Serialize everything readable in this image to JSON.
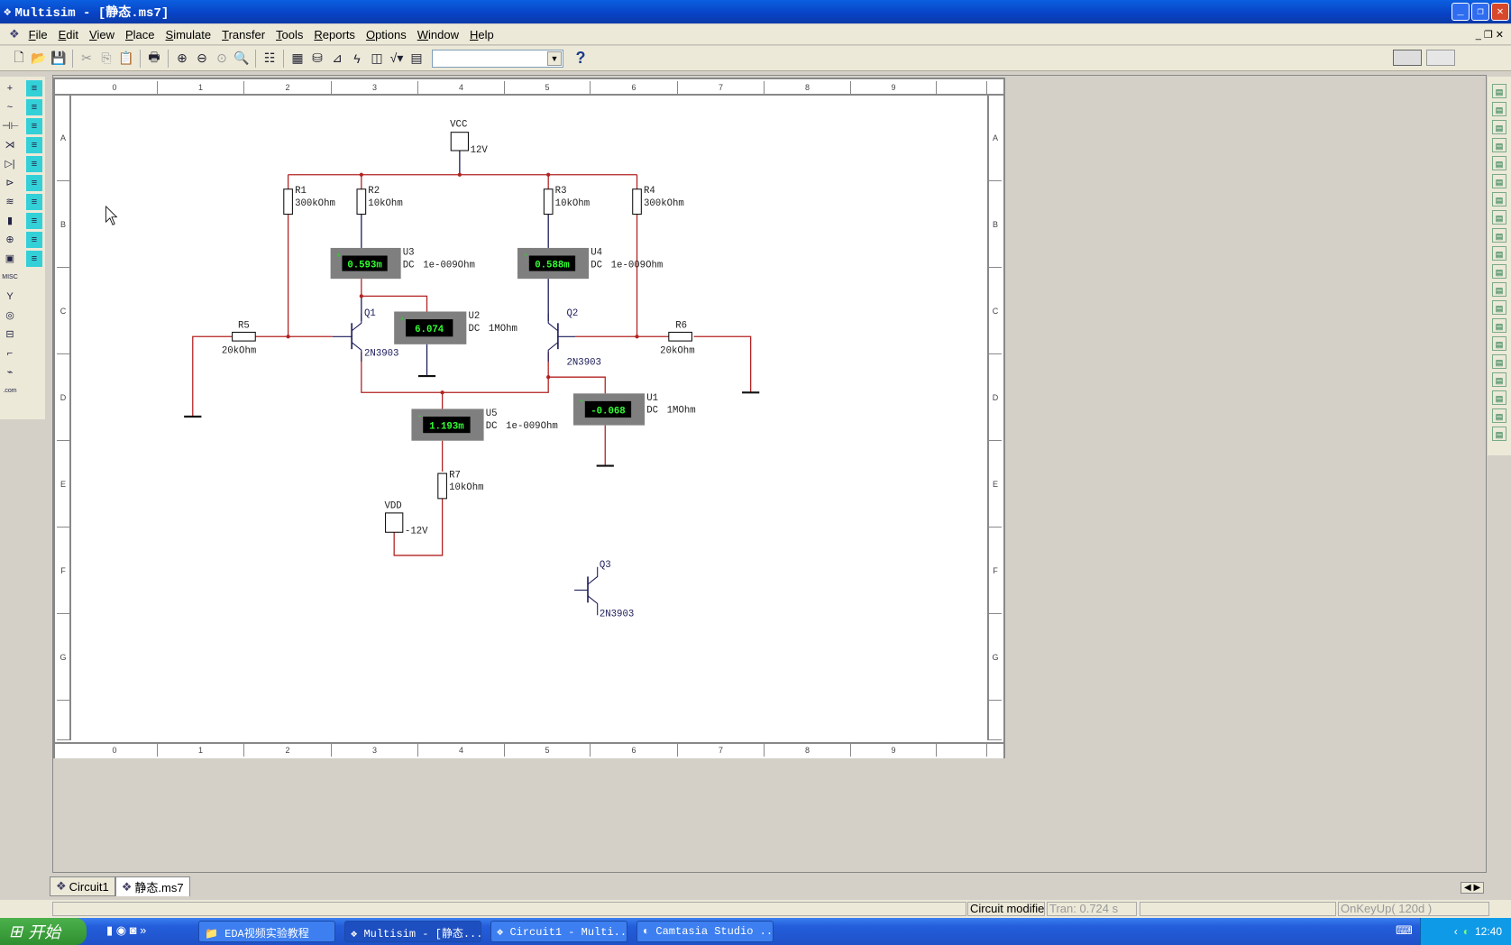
{
  "window": {
    "title": "Multisim - [静态.ms7]",
    "controls": [
      "minimize",
      "restore",
      "close"
    ]
  },
  "menu": [
    "File",
    "Edit",
    "View",
    "Place",
    "Simulate",
    "Transfer",
    "Tools",
    "Reports",
    "Options",
    "Window",
    "Help"
  ],
  "toolbar": {
    "icons": [
      "new-icon",
      "open-icon",
      "save-icon",
      "cut-icon",
      "copy-icon",
      "paste-icon",
      "print-icon",
      "zoom-in-icon",
      "zoom-out-icon",
      "zoom-area-icon",
      "zoom-fit-icon",
      "hierarchy-icon",
      "spreadsheet-icon",
      "database-icon",
      "postprocessor-icon",
      "erc-icon",
      "grapher-icon",
      "analysis-icon",
      "instrument-icon"
    ],
    "dropdown_value": "",
    "help": "?"
  },
  "sheet": {
    "columns": [
      "0",
      "1",
      "2",
      "3",
      "4",
      "5",
      "6",
      "7",
      "8",
      "9"
    ],
    "rows": [
      "A",
      "B",
      "C",
      "D",
      "E",
      "F",
      "G"
    ]
  },
  "circuit": {
    "vcc": {
      "name": "VCC",
      "value": "12V"
    },
    "vdd": {
      "name": "VDD",
      "value": "-12V"
    },
    "resistors": {
      "R1": {
        "name": "R1",
        "value": "300kOhm"
      },
      "R2": {
        "name": "R2",
        "value": "10kOhm"
      },
      "R3": {
        "name": "R3",
        "value": "10kOhm"
      },
      "R4": {
        "name": "R4",
        "value": "300kOhm"
      },
      "R5": {
        "name": "R5",
        "value": "20kOhm"
      },
      "R6": {
        "name": "R6",
        "value": "20kOhm"
      },
      "R7": {
        "name": "R7",
        "value": "10kOhm"
      }
    },
    "transistors": {
      "Q1": {
        "name": "Q1",
        "model": "2N3903"
      },
      "Q2": {
        "name": "Q2",
        "model": "2N3903"
      },
      "Q3": {
        "name": "Q3",
        "model": "2N3903"
      }
    },
    "meters": {
      "U1": {
        "name": "U1",
        "reading": "-0.068",
        "mode": "DC",
        "resistance": "1MOhm"
      },
      "U2": {
        "name": "U2",
        "reading": "6.074",
        "mode": "DC",
        "resistance": "1MOhm"
      },
      "U3": {
        "name": "U3",
        "reading": "0.593m",
        "mode": "DC",
        "resistance": "1e-009Ohm"
      },
      "U4": {
        "name": "U4",
        "reading": "0.588m",
        "mode": "DC",
        "resistance": "1e-009Ohm"
      },
      "U5": {
        "name": "U5",
        "reading": "1.193m",
        "mode": "DC",
        "resistance": "1e-009Ohm"
      }
    },
    "wire_color": "#b22222",
    "meter_text_color": "#33ff33"
  },
  "tabs": [
    {
      "label": "Circuit1"
    },
    {
      "label": "静态.ms7",
      "active": true
    }
  ],
  "status": {
    "message": "Circuit modified",
    "tran": "Tran: 0.724 s",
    "event": "OnKeyUp( 120d )"
  },
  "taskbar": {
    "start": "开始",
    "tasks": [
      "EDA视频实验教程",
      "Multisim - [静态...",
      "Circuit1 - Multi...",
      "Camtasia Studio ..."
    ],
    "clock": "12:40"
  }
}
